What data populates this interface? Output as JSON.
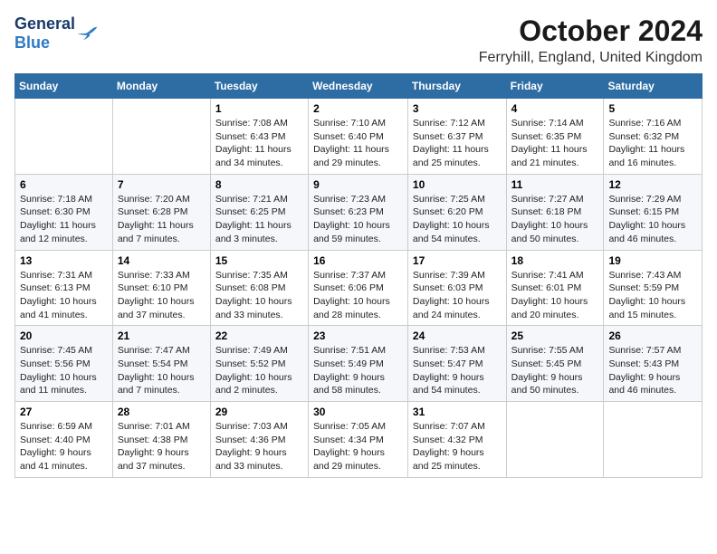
{
  "header": {
    "logo_general": "General",
    "logo_blue": "Blue",
    "title": "October 2024",
    "location": "Ferryhill, England, United Kingdom"
  },
  "weekdays": [
    "Sunday",
    "Monday",
    "Tuesday",
    "Wednesday",
    "Thursday",
    "Friday",
    "Saturday"
  ],
  "weeks": [
    [
      {
        "day": "",
        "text": ""
      },
      {
        "day": "",
        "text": ""
      },
      {
        "day": "1",
        "text": "Sunrise: 7:08 AM\nSunset: 6:43 PM\nDaylight: 11 hours\nand 34 minutes."
      },
      {
        "day": "2",
        "text": "Sunrise: 7:10 AM\nSunset: 6:40 PM\nDaylight: 11 hours\nand 29 minutes."
      },
      {
        "day": "3",
        "text": "Sunrise: 7:12 AM\nSunset: 6:37 PM\nDaylight: 11 hours\nand 25 minutes."
      },
      {
        "day": "4",
        "text": "Sunrise: 7:14 AM\nSunset: 6:35 PM\nDaylight: 11 hours\nand 21 minutes."
      },
      {
        "day": "5",
        "text": "Sunrise: 7:16 AM\nSunset: 6:32 PM\nDaylight: 11 hours\nand 16 minutes."
      }
    ],
    [
      {
        "day": "6",
        "text": "Sunrise: 7:18 AM\nSunset: 6:30 PM\nDaylight: 11 hours\nand 12 minutes."
      },
      {
        "day": "7",
        "text": "Sunrise: 7:20 AM\nSunset: 6:28 PM\nDaylight: 11 hours\nand 7 minutes."
      },
      {
        "day": "8",
        "text": "Sunrise: 7:21 AM\nSunset: 6:25 PM\nDaylight: 11 hours\nand 3 minutes."
      },
      {
        "day": "9",
        "text": "Sunrise: 7:23 AM\nSunset: 6:23 PM\nDaylight: 10 hours\nand 59 minutes."
      },
      {
        "day": "10",
        "text": "Sunrise: 7:25 AM\nSunset: 6:20 PM\nDaylight: 10 hours\nand 54 minutes."
      },
      {
        "day": "11",
        "text": "Sunrise: 7:27 AM\nSunset: 6:18 PM\nDaylight: 10 hours\nand 50 minutes."
      },
      {
        "day": "12",
        "text": "Sunrise: 7:29 AM\nSunset: 6:15 PM\nDaylight: 10 hours\nand 46 minutes."
      }
    ],
    [
      {
        "day": "13",
        "text": "Sunrise: 7:31 AM\nSunset: 6:13 PM\nDaylight: 10 hours\nand 41 minutes."
      },
      {
        "day": "14",
        "text": "Sunrise: 7:33 AM\nSunset: 6:10 PM\nDaylight: 10 hours\nand 37 minutes."
      },
      {
        "day": "15",
        "text": "Sunrise: 7:35 AM\nSunset: 6:08 PM\nDaylight: 10 hours\nand 33 minutes."
      },
      {
        "day": "16",
        "text": "Sunrise: 7:37 AM\nSunset: 6:06 PM\nDaylight: 10 hours\nand 28 minutes."
      },
      {
        "day": "17",
        "text": "Sunrise: 7:39 AM\nSunset: 6:03 PM\nDaylight: 10 hours\nand 24 minutes."
      },
      {
        "day": "18",
        "text": "Sunrise: 7:41 AM\nSunset: 6:01 PM\nDaylight: 10 hours\nand 20 minutes."
      },
      {
        "day": "19",
        "text": "Sunrise: 7:43 AM\nSunset: 5:59 PM\nDaylight: 10 hours\nand 15 minutes."
      }
    ],
    [
      {
        "day": "20",
        "text": "Sunrise: 7:45 AM\nSunset: 5:56 PM\nDaylight: 10 hours\nand 11 minutes."
      },
      {
        "day": "21",
        "text": "Sunrise: 7:47 AM\nSunset: 5:54 PM\nDaylight: 10 hours\nand 7 minutes."
      },
      {
        "day": "22",
        "text": "Sunrise: 7:49 AM\nSunset: 5:52 PM\nDaylight: 10 hours\nand 2 minutes."
      },
      {
        "day": "23",
        "text": "Sunrise: 7:51 AM\nSunset: 5:49 PM\nDaylight: 9 hours\nand 58 minutes."
      },
      {
        "day": "24",
        "text": "Sunrise: 7:53 AM\nSunset: 5:47 PM\nDaylight: 9 hours\nand 54 minutes."
      },
      {
        "day": "25",
        "text": "Sunrise: 7:55 AM\nSunset: 5:45 PM\nDaylight: 9 hours\nand 50 minutes."
      },
      {
        "day": "26",
        "text": "Sunrise: 7:57 AM\nSunset: 5:43 PM\nDaylight: 9 hours\nand 46 minutes."
      }
    ],
    [
      {
        "day": "27",
        "text": "Sunrise: 6:59 AM\nSunset: 4:40 PM\nDaylight: 9 hours\nand 41 minutes."
      },
      {
        "day": "28",
        "text": "Sunrise: 7:01 AM\nSunset: 4:38 PM\nDaylight: 9 hours\nand 37 minutes."
      },
      {
        "day": "29",
        "text": "Sunrise: 7:03 AM\nSunset: 4:36 PM\nDaylight: 9 hours\nand 33 minutes."
      },
      {
        "day": "30",
        "text": "Sunrise: 7:05 AM\nSunset: 4:34 PM\nDaylight: 9 hours\nand 29 minutes."
      },
      {
        "day": "31",
        "text": "Sunrise: 7:07 AM\nSunset: 4:32 PM\nDaylight: 9 hours\nand 25 minutes."
      },
      {
        "day": "",
        "text": ""
      },
      {
        "day": "",
        "text": ""
      }
    ]
  ]
}
